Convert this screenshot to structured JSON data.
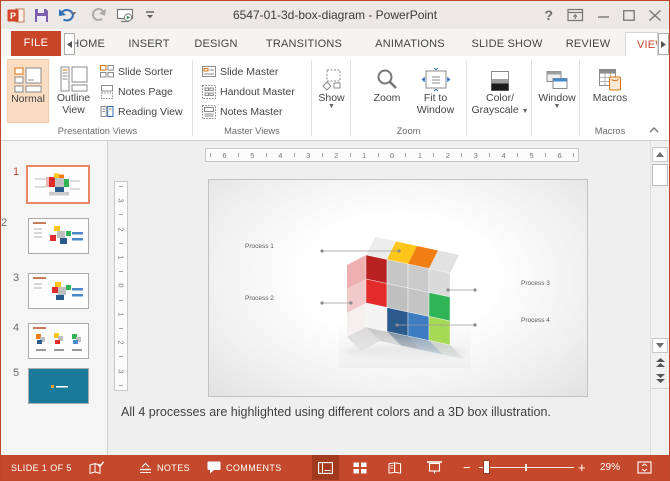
{
  "window": {
    "title": "6547-01-3d-box-diagram - PowerPoint"
  },
  "title_bar": {
    "help": "?"
  },
  "tabs": {
    "file": "FILE",
    "items": [
      "HOME",
      "INSERT",
      "DESIGN",
      "TRANSITIONS",
      "ANIMATIONS",
      "SLIDE SHOW",
      "REVIEW"
    ],
    "active": "VIEW"
  },
  "ribbon": {
    "presentation_views": {
      "group_label": "Presentation Views",
      "normal": "Normal",
      "outline_line1": "Outline",
      "outline_line2": "View",
      "slide_sorter": "Slide Sorter",
      "notes_page": "Notes Page",
      "reading_view": "Reading View"
    },
    "master_views": {
      "group_label": "Master Views",
      "slide_master": "Slide Master",
      "handout_master": "Handout Master",
      "notes_master": "Notes Master"
    },
    "show": {
      "button": "Show"
    },
    "zoom": {
      "group_label": "Zoom",
      "zoom": "Zoom",
      "fit_line1": "Fit to",
      "fit_line2": "Window"
    },
    "color_grayscale": {
      "line1": "Color/",
      "line2": "Grayscale"
    },
    "window_group": {
      "button": "Window"
    },
    "macros": {
      "group_label": "Macros",
      "button": "Macros"
    }
  },
  "rulers": {
    "horizontal": [
      "6",
      "5",
      "4",
      "3",
      "2",
      "1",
      "0",
      "1",
      "2",
      "3",
      "4",
      "5",
      "6"
    ],
    "vertical": [
      "3",
      "2",
      "1",
      "0",
      "1",
      "2",
      "3"
    ]
  },
  "slides_panel": {
    "slides": [
      {
        "num": "1"
      },
      {
        "num": "2"
      },
      {
        "num": "3"
      },
      {
        "num": "4"
      },
      {
        "num": "5"
      }
    ]
  },
  "slide": {
    "process1": "Process 1",
    "process2": "Process 2",
    "process3": "Process 3",
    "process4": "Process 4"
  },
  "notes": {
    "text": "All 4 processes are highlighted using different colors and a 3D box illustration."
  },
  "status_bar": {
    "slide_indicator": "SLIDE 1 OF 5",
    "notes": "NOTES",
    "comments": "COMMENTS",
    "zoom_out": "−",
    "zoom_in": "+",
    "zoom_percent": "29%"
  },
  "colors": {
    "chrome_red": "#C4492C",
    "file_tab_red": "#C8452A",
    "selection_orange": "#E98865",
    "normal_button_highlight": "#FADCC3",
    "status_active_view": "#A23A20",
    "thumb5_teal": "#1B7A99",
    "cube": {
      "dark_red": "#B92020",
      "red": "#E32B2B",
      "yellow": "#FFC518",
      "orange": "#F07E14",
      "green": "#2FB457",
      "light_green": "#A6D954",
      "dark_blue": "#2B5A8F",
      "blue": "#3E7CC1",
      "gray_top": "#C6C6C6",
      "gray_mid": "#BFBFBF",
      "white_cell": "#F4F4F4"
    }
  }
}
